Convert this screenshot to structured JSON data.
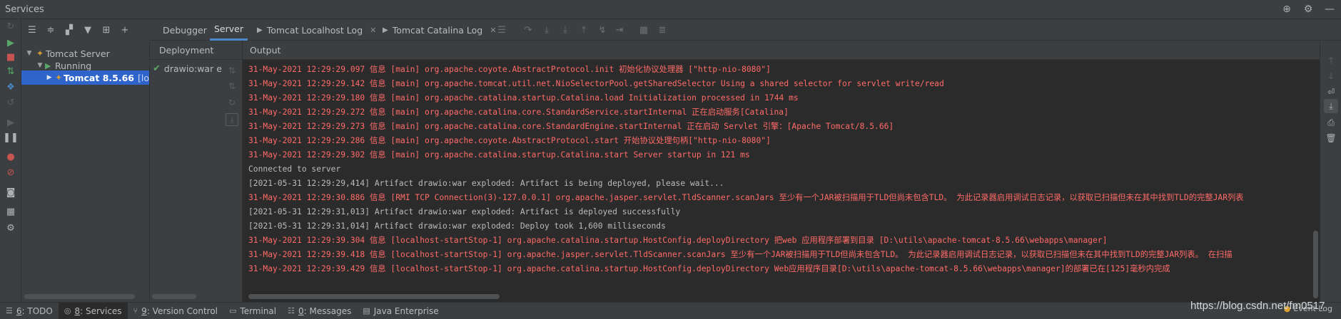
{
  "window": {
    "title": "Services"
  },
  "tree": {
    "items": [
      {
        "label": "Tomcat Server"
      },
      {
        "label": "Running"
      },
      {
        "label": "Tomcat 8.5.66",
        "suffix": "[lo"
      }
    ]
  },
  "tabs": [
    {
      "label": "Debugger"
    },
    {
      "label": "Server"
    },
    {
      "label": "Tomcat Localhost Log"
    },
    {
      "label": "Tomcat Catalina Log"
    }
  ],
  "deployment": {
    "header": "Deployment",
    "item": "drawio:war e"
  },
  "output": {
    "header": "Output",
    "lines": [
      {
        "text": "31-May-2021 12:29:29.097 信息 [main] org.apache.coyote.AbstractProtocol.init 初始化协议处理器 [\"http-nio-8080\"]",
        "color": "red"
      },
      {
        "text": "31-May-2021 12:29:29.142 信息 [main] org.apache.tomcat.util.net.NioSelectorPool.getSharedSelector Using a shared selector for servlet write/read",
        "color": "red"
      },
      {
        "text": "31-May-2021 12:29:29.180 信息 [main] org.apache.catalina.startup.Catalina.load Initialization processed in 1744 ms",
        "color": "red"
      },
      {
        "text": "31-May-2021 12:29:29.272 信息 [main] org.apache.catalina.core.StandardService.startInternal 正在启动服务[Catalina]",
        "color": "red"
      },
      {
        "text": "31-May-2021 12:29:29.273 信息 [main] org.apache.catalina.core.StandardEngine.startInternal 正在启动 Servlet 引擎：[Apache Tomcat/8.5.66]",
        "color": "red"
      },
      {
        "text": "31-May-2021 12:29:29.286 信息 [main] org.apache.coyote.AbstractProtocol.start 开始协议处理句柄[\"http-nio-8080\"]",
        "color": "red"
      },
      {
        "text": "31-May-2021 12:29:29.302 信息 [main] org.apache.catalina.startup.Catalina.start Server startup in 121 ms",
        "color": "red"
      },
      {
        "text": "Connected to server",
        "color": "plain"
      },
      {
        "text": "[2021-05-31 12:29:29,414] Artifact drawio:war exploded: Artifact is being deployed, please wait...",
        "color": "plain"
      },
      {
        "text": "31-May-2021 12:29:30.886 信息 [RMI TCP Connection(3)-127.0.0.1] org.apache.jasper.servlet.TldScanner.scanJars 至少有一个JAR被扫描用于TLD但尚未包含TLD。 为此记录器启用调试日志记录，以获取已扫描但未在其中找到TLD的完整JAR列表",
        "color": "red"
      },
      {
        "text": "[2021-05-31 12:29:31,013] Artifact drawio:war exploded: Artifact is deployed successfully",
        "color": "plain"
      },
      {
        "text": "[2021-05-31 12:29:31,014] Artifact drawio:war exploded: Deploy took 1,600 milliseconds",
        "color": "plain"
      },
      {
        "text": "31-May-2021 12:29:39.304 信息 [localhost-startStop-1] org.apache.catalina.startup.HostConfig.deployDirectory 把web 应用程序部署到目录 [D:\\utils\\apache-tomcat-8.5.66\\webapps\\manager]",
        "color": "red"
      },
      {
        "text": "31-May-2021 12:29:39.418 信息 [localhost-startStop-1] org.apache.jasper.servlet.TldScanner.scanJars 至少有一个JAR被扫描用于TLD但尚未包含TLD。 为此记录器启用调试日志记录，以获取已扫描但未在其中找到TLD的完整JAR列表。 在扫描",
        "color": "red"
      },
      {
        "text": "31-May-2021 12:29:39.429 信息 [localhost-startStop-1] org.apache.catalina.startup.HostConfig.deployDirectory Web应用程序目录[D:\\utils\\apache-tomcat-8.5.66\\webapps\\manager]的部署已在[125]毫秒内完成",
        "color": "red"
      }
    ]
  },
  "statusbar": {
    "items": [
      {
        "num": "6",
        "label": ": TODO"
      },
      {
        "num": "8",
        "label": ": Services"
      },
      {
        "num": "9",
        "label": ": Version Control"
      },
      {
        "num": "",
        "label": "Terminal"
      },
      {
        "num": "0",
        "label": ": Messages"
      },
      {
        "num": "",
        "label": "Java Enterprise"
      }
    ],
    "event_log": "Event Log",
    "watermark": "https://blog.csdn.net/fm0517"
  },
  "colors": {
    "accent": "#2f65ca",
    "error_text": "#ff6b68",
    "run_green": "#59a869"
  }
}
